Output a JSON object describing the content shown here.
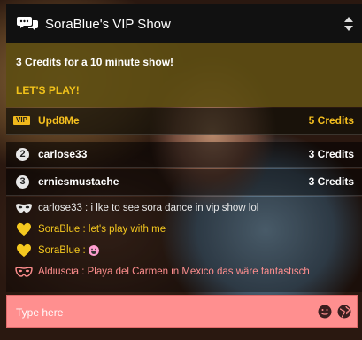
{
  "header": {
    "title": "SoraBlue's VIP Show",
    "chat_icon": "chat-bubbles-icon",
    "sort_icon": "sort-arrows-icon"
  },
  "promo": {
    "line": "3 Credits for a 10 minute show!",
    "cta": "LET'S PLAY!"
  },
  "leaderboard": [
    {
      "badge": "VIP",
      "name": "Upd8Me",
      "amount": "5 Credits",
      "color": "#f5bf1f"
    },
    {
      "rank": "2",
      "name": "carlose33",
      "amount": "3 Credits"
    },
    {
      "rank": "3",
      "name": "erniesmustache",
      "amount": "3 Credits"
    }
  ],
  "messages": [
    {
      "icon": "mask-icon",
      "text": "carlose33 : i lke to see sora dance in vip show lol",
      "color": "#e9e9e9"
    },
    {
      "icon": "heart-icon",
      "text": "SoraBlue : let's play with me",
      "color": "#f5c81f"
    },
    {
      "icon": "heart-icon",
      "text": "SoraBlue : ",
      "color": "#f5c81f"
    },
    {
      "icon": "mask-icon",
      "text": "Aldiuscia : Playa del Carmen in Mexico das wäre fantastisch",
      "color": "#ff8e8e"
    }
  ],
  "input": {
    "placeholder": "Type here",
    "emoji_icon": "smiley-icon",
    "language_icon": "globe-icon"
  },
  "colors": {
    "accent": "#f5bf1f",
    "input_bg": "#ff8f8f"
  }
}
